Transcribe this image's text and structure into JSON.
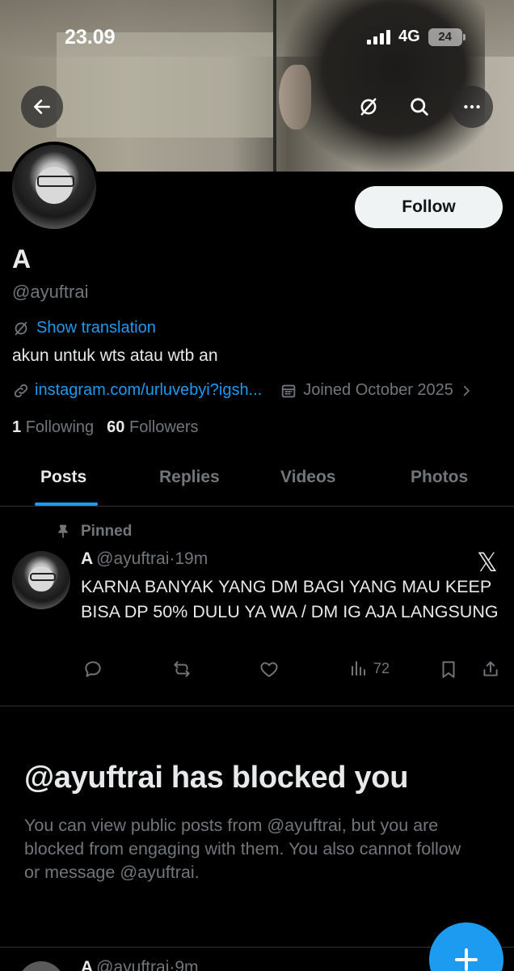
{
  "status_bar": {
    "time": "23.09",
    "network": "4G",
    "battery": "24"
  },
  "header": {
    "back_icon": "arrow-left-icon",
    "translate_icon": "translate-off-icon",
    "search_icon": "search-icon",
    "more_icon": "more-horizontal-icon"
  },
  "profile": {
    "display_name": "A",
    "handle": "@ayuftrai",
    "show_translation": "Show translation",
    "bio": "akun untuk wts atau wtb an",
    "link": "instagram.com/urluvebyi?igsh...",
    "joined": "Joined October 2025",
    "following_count": "1",
    "following_label": "Following",
    "followers_count": "60",
    "followers_label": "Followers",
    "follow_button": "Follow"
  },
  "tabs": [
    {
      "label": "Posts",
      "active": true
    },
    {
      "label": "Replies",
      "active": false
    },
    {
      "label": "Videos",
      "active": false
    },
    {
      "label": "Photos",
      "active": false
    }
  ],
  "pinned_post": {
    "pinned_label": "Pinned",
    "author": "A",
    "handle": "@ayuftrai",
    "separator": "·",
    "time": "19m",
    "text": "KARNA BANYAK YANG DM BAGI YANG MAU KEEP BISA DP 50% DULU YA WA / DM IG AJA LANGSUNG",
    "views": "72"
  },
  "blocked": {
    "title": "@ayuftrai has blocked you",
    "description": "You can view public posts from @ayuftrai, but you are blocked from engaging with them. You also cannot follow or message @ayuftrai."
  },
  "next_post": {
    "author": "A",
    "handle": "@ayuftrai",
    "separator": "·",
    "time": "9m"
  },
  "colors": {
    "accent": "#1d9bf0",
    "background": "#000000",
    "muted": "#71767b",
    "text": "#e7e9ea"
  }
}
